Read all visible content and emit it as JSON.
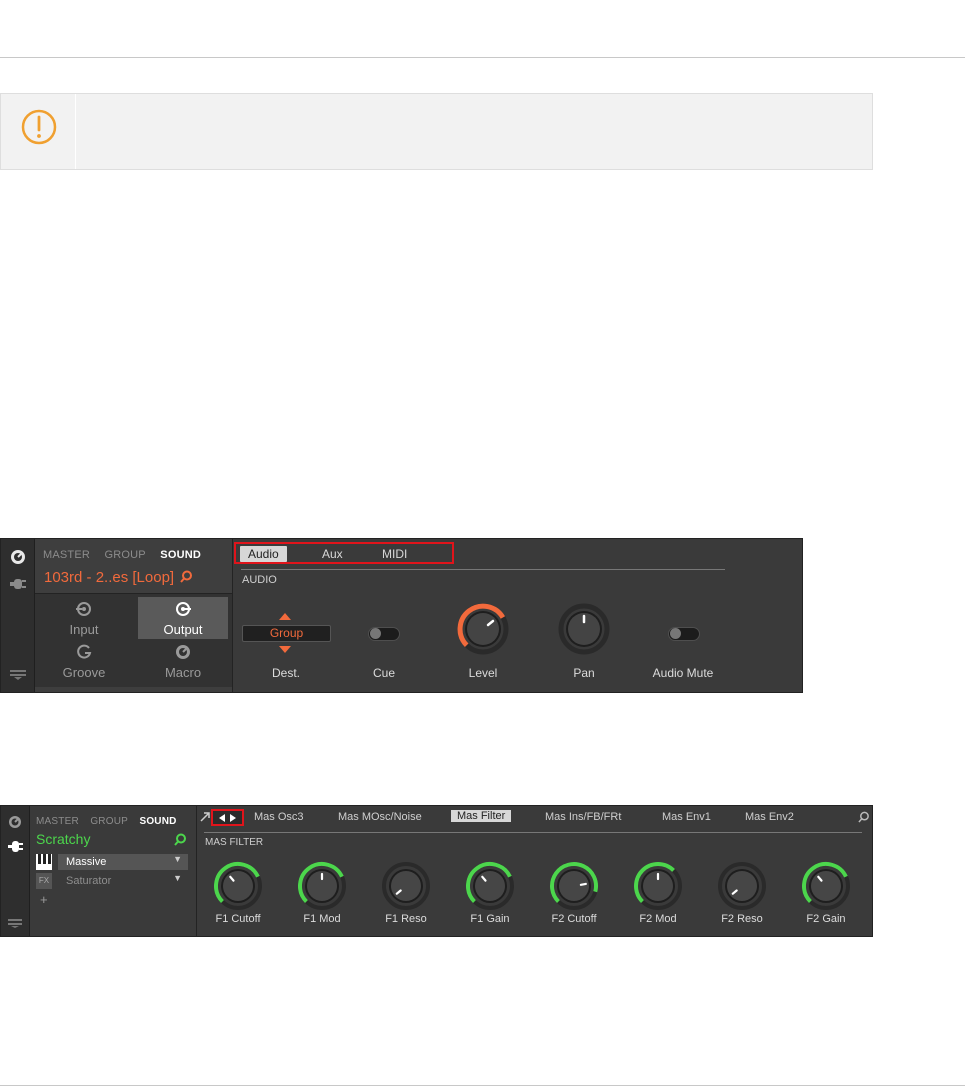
{
  "panel1": {
    "nav_tabs": [
      "MASTER",
      "GROUP",
      "SOUND"
    ],
    "sound_name": "103rd - 2..es [Loop]",
    "cells": [
      "Input",
      "Output",
      "Groove",
      "Macro"
    ],
    "tabs": [
      "Audio",
      "Aux",
      "MIDI"
    ],
    "section_title": "AUDIO",
    "dest_value": "Group",
    "controls": {
      "dest": "Dest.",
      "cue": "Cue",
      "level": "Level",
      "pan": "Pan",
      "audio_mute": "Audio Mute"
    },
    "colors": {
      "accent": "#f26a3c",
      "highlight_box": "#e0141b"
    }
  },
  "panel2": {
    "nav_tabs": [
      "MASTER",
      "GROUP",
      "SOUND"
    ],
    "sound_name": "Scratchy",
    "plugins": [
      {
        "badge": "",
        "name": "Massive"
      },
      {
        "badge": "FX",
        "name": "Saturator"
      }
    ],
    "add_symbol": "+",
    "page_tabs": [
      "Mas Osc3",
      "Mas MOsc/Noise",
      "Mas Filter",
      "Mas Ins/FB/FRt",
      "Mas Env1",
      "Mas Env2"
    ],
    "section_title": "MAS FILTER",
    "knobs": [
      {
        "label": "F1 Cutoff",
        "active": true
      },
      {
        "label": "F1 Mod",
        "active": true
      },
      {
        "label": "F1 Reso",
        "active": false
      },
      {
        "label": "F1 Gain",
        "active": true
      },
      {
        "label": "F2 Cutoff",
        "active": true
      },
      {
        "label": "F2 Mod",
        "active": true
      },
      {
        "label": "F2 Reso",
        "active": false
      },
      {
        "label": "F2 Gain",
        "active": true
      }
    ],
    "colors": {
      "accent": "#4cd64c"
    }
  },
  "note_box": {
    "icon": "warning-icon",
    "color": "#f0a030"
  }
}
